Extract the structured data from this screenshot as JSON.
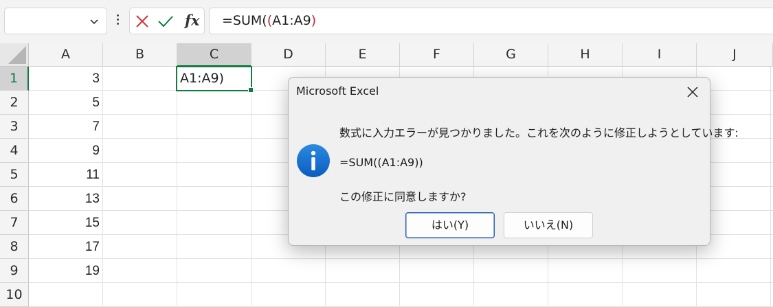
{
  "formula_bar": {
    "name_box_value": "",
    "cancel_icon": "x-icon",
    "enter_icon": "check-icon",
    "fx_label": "fx",
    "formula_prefix": "=SUM(",
    "formula_paren": "(",
    "formula_rest": "A1:A9",
    "formula_close": ")"
  },
  "grid": {
    "columns": [
      "A",
      "B",
      "C",
      "D",
      "E",
      "F",
      "G",
      "H",
      "I",
      "J"
    ],
    "rows": [
      "1",
      "2",
      "3",
      "4",
      "5",
      "6",
      "7",
      "8",
      "9",
      "10"
    ],
    "column_a_values": [
      "3",
      "5",
      "7",
      "9",
      "11",
      "13",
      "15",
      "17",
      "19"
    ],
    "active_cell_text": "A1:A9)",
    "selected_column": "C",
    "selected_row": "1",
    "accent_color": "#107c41"
  },
  "dialog": {
    "title": "Microsoft Excel",
    "message_line1": "数式に入力エラーが見つかりました。これを次のように修正しようとしています:",
    "suggested_formula": "=SUM((A1:A9))",
    "question": "この修正に同意しますか?",
    "yes_label": "はい(Y)",
    "no_label": "いいえ(N)",
    "icon": "info-icon"
  }
}
